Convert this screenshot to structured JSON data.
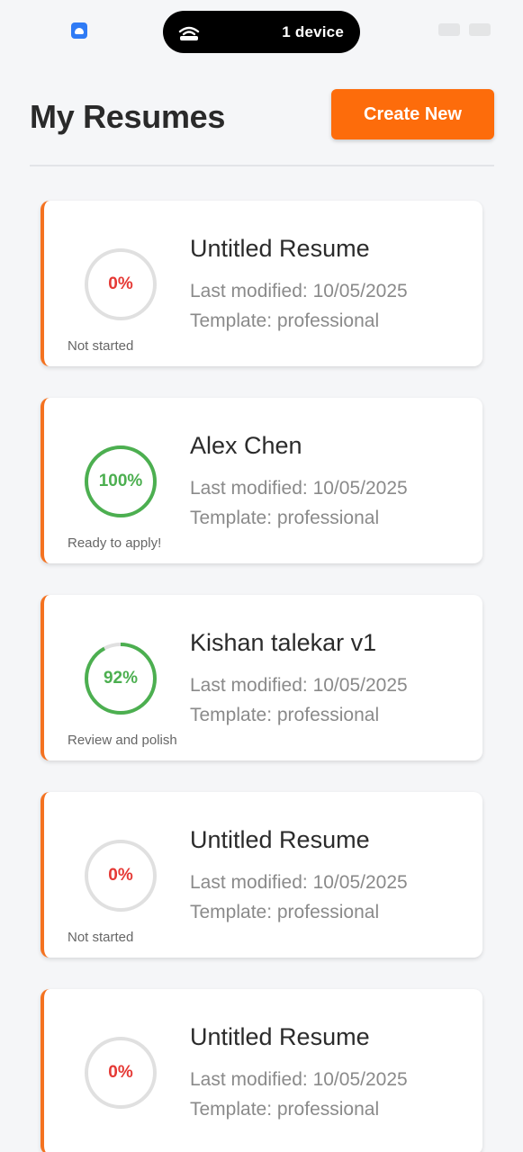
{
  "status_bar": {
    "device_pill_text": "1 device"
  },
  "header": {
    "title": "My Resumes",
    "create_button_label": "Create New"
  },
  "colors": {
    "accent": "#fd6c0b",
    "card_border": "#f47220",
    "progress_complete": "#4caf50",
    "progress_zero": "#e53935",
    "ring_track": "#e0e0e0"
  },
  "resumes": [
    {
      "title": "Untitled Resume",
      "last_modified": "Last modified: 10/05/2025",
      "template": "Template: professional",
      "progress_label": "0%",
      "progress": 0,
      "status": "Not started"
    },
    {
      "title": "Alex Chen",
      "last_modified": "Last modified: 10/05/2025",
      "template": "Template: professional",
      "progress_label": "100%",
      "progress": 100,
      "status": "Ready to apply!"
    },
    {
      "title": "Kishan talekar v1",
      "last_modified": "Last modified: 10/05/2025",
      "template": "Template: professional",
      "progress_label": "92%",
      "progress": 92,
      "status": "Review and polish"
    },
    {
      "title": "Untitled Resume",
      "last_modified": "Last modified: 10/05/2025",
      "template": "Template: professional",
      "progress_label": "0%",
      "progress": 0,
      "status": "Not started"
    },
    {
      "title": "Untitled Resume",
      "last_modified": "Last modified: 10/05/2025",
      "template": "Template: professional",
      "progress_label": "0%",
      "progress": 0,
      "status": ""
    }
  ]
}
